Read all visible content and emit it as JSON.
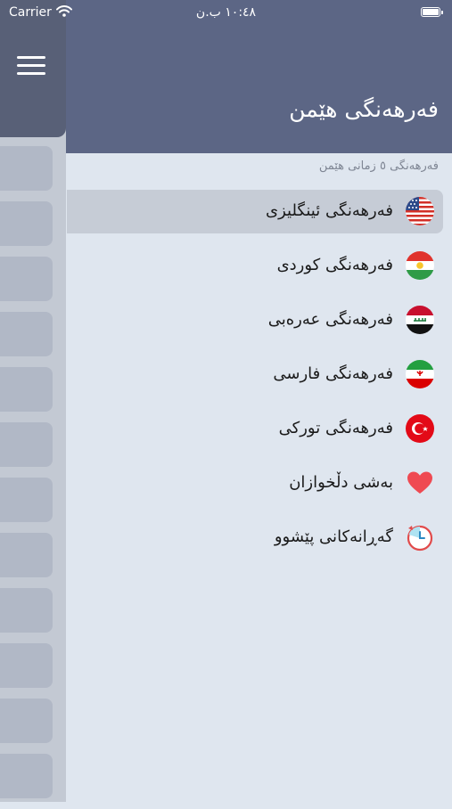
{
  "status_bar": {
    "carrier": "Carrier",
    "time": "١٠:٤٨ ب.ن"
  },
  "header": {
    "title": "فەرهەنگی هێمن"
  },
  "subtitle": "فەرهەنگی ٥ زمانی هێمن",
  "menu": {
    "items": [
      {
        "label": "فەرهەنگی ئینگلیزی",
        "icon": "usa-flag-icon"
      },
      {
        "label": "فەرهەنگی کوردی",
        "icon": "kurdistan-flag-icon"
      },
      {
        "label": "فەرهەنگی عەرەبی",
        "icon": "iraq-flag-icon"
      },
      {
        "label": "فەرهەنگی فارسی",
        "icon": "iran-flag-icon"
      },
      {
        "label": "فەرهەنگی تورکی",
        "icon": "turkey-flag-icon"
      },
      {
        "label": "بەشی دڵخوازان",
        "icon": "heart-icon"
      },
      {
        "label": "گەڕانەکانی پێشوو",
        "icon": "history-clock-icon"
      }
    ],
    "selected_index": 0
  },
  "colors": {
    "header": "#5c6685",
    "background": "#dfe6ef",
    "selected_row": "#c6ccd6",
    "drawer": "#c3c9d3"
  }
}
